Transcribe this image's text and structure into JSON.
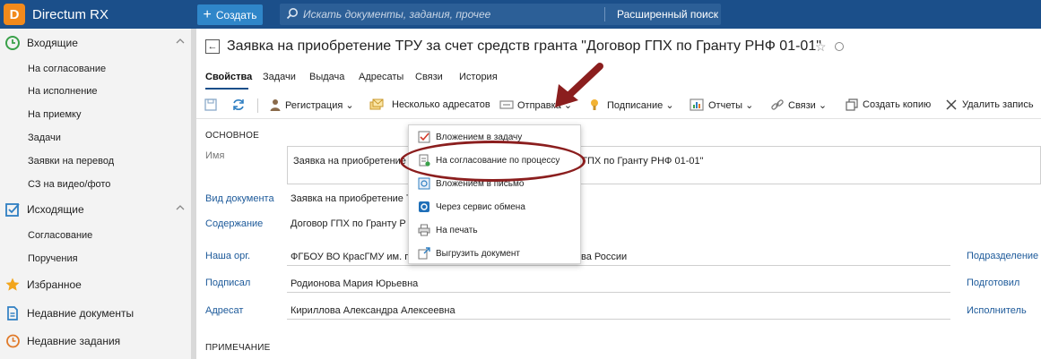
{
  "app": {
    "logo_glyph": "D",
    "name": "Directum RX",
    "brand_color": "#1b4f8a",
    "accent_color": "#f28a1c"
  },
  "topbar": {
    "create_label": "Создать",
    "search_placeholder": "Искать документы, задания, прочее",
    "advanced_search_label": "Расширенный поиск"
  },
  "sidebar": {
    "groups": [
      {
        "label": "Входящие",
        "icon": "clock-icon",
        "items": [
          "На согласование",
          "На исполнение",
          "На приемку",
          "Задачи",
          "Заявки на перевод",
          "СЗ на видео/фото"
        ]
      },
      {
        "label": "Исходящие",
        "icon": "checkbox-icon",
        "items": [
          "Согласование",
          "Поручения"
        ]
      },
      {
        "label": "Избранное",
        "icon": "star-icon",
        "items": []
      },
      {
        "label": "Недавние документы",
        "icon": "document-icon",
        "items": []
      },
      {
        "label": "Недавние задания",
        "icon": "history-icon",
        "items": []
      }
    ]
  },
  "document": {
    "title": "Заявка на приобретение ТРУ за счет средств гранта \"Договор ГПХ по Гранту РНФ 01-01\""
  },
  "tabs": [
    "Свойства",
    "Задачи",
    "Выдача",
    "Адресаты",
    "Связи",
    "История"
  ],
  "toolbar": {
    "registration": "Регистрация",
    "multiple_recipients": "Несколько адресатов",
    "send": "Отправка",
    "signing": "Подписание",
    "reports": "Отчеты",
    "links": "Связи",
    "create_copy": "Создать копию",
    "delete_record": "Удалить запись"
  },
  "form": {
    "section_main": "ОСНОВНОЕ",
    "name_label": "Имя",
    "name_value_left": "Заявка на приобретение",
    "name_value_right": "ГПХ по Гранту РНФ 01-01\"",
    "doc_kind_label": "Вид документа",
    "doc_kind_value": "Заявка на приобретение Т",
    "content_label": "Содержание",
    "content_value": "Договор ГПХ по Гранту Р",
    "org_label": "Наша орг.",
    "org_value_left": "ФГБОУ ВО КрасГМУ им. пр",
    "org_value_right": "ва России",
    "signed_label": "Подписал",
    "signed_value": "Родионова Мария Юрьевна",
    "addressee_label": "Адресат",
    "addressee_value": "Кириллова Александра Алексеевна",
    "section_note": "ПРИМЕЧАНИЕ",
    "right_subdivision": "Подразделение",
    "right_prepared": "Подготовил",
    "right_executor": "Исполнитель"
  },
  "send_menu": {
    "items": [
      {
        "label": "Вложением в задачу",
        "icon": "task-attach-icon"
      },
      {
        "label": "На согласование по процессу",
        "icon": "approval-process-icon"
      },
      {
        "label": "Вложением в письмо",
        "icon": "email-icon"
      },
      {
        "label": "Через сервис обмена",
        "icon": "exchange-service-icon"
      },
      {
        "label": "На печать",
        "icon": "printer-icon"
      },
      {
        "label": "Выгрузить документ",
        "icon": "export-icon"
      }
    ]
  },
  "annotation_color": "#8b1e1e"
}
